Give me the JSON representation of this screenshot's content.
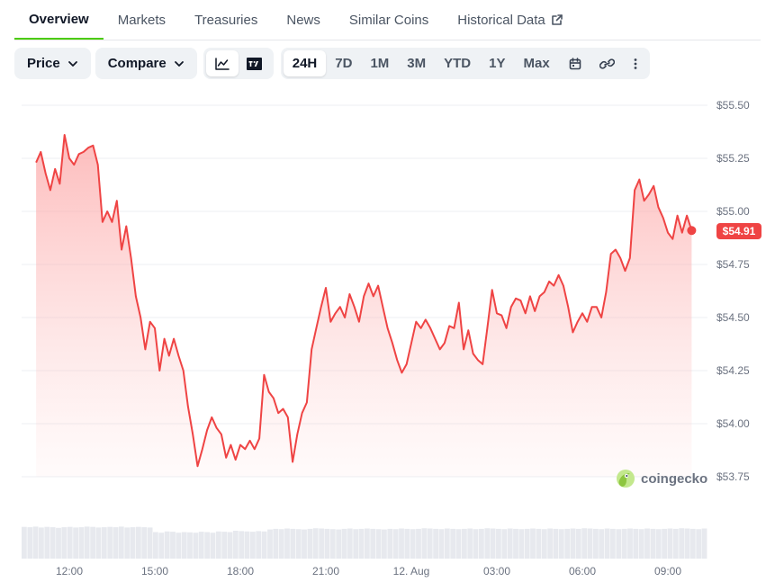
{
  "tabs": [
    {
      "label": "Overview",
      "active": true
    },
    {
      "label": "Markets",
      "active": false
    },
    {
      "label": "Treasuries",
      "active": false
    },
    {
      "label": "News",
      "active": false
    },
    {
      "label": "Similar Coins",
      "active": false
    },
    {
      "label": "Historical Data",
      "active": false,
      "icon": "external-link-icon"
    }
  ],
  "toolbar": {
    "price_label": "Price",
    "compare_label": "Compare",
    "chart_types": [
      {
        "icon": "line-chart-icon",
        "active": true
      },
      {
        "icon": "tradingview-icon",
        "active": false
      }
    ],
    "ranges": [
      {
        "label": "24H",
        "active": true
      },
      {
        "label": "7D",
        "active": false
      },
      {
        "label": "1M",
        "active": false
      },
      {
        "label": "3M",
        "active": false
      },
      {
        "label": "YTD",
        "active": false
      },
      {
        "label": "1Y",
        "active": false
      },
      {
        "label": "Max",
        "active": false
      }
    ],
    "extra_icons": [
      "calendar-icon",
      "link-icon",
      "more-vertical-icon"
    ]
  },
  "watermark": "coingecko",
  "colors": {
    "accent": "#4bcc00",
    "line": "#ef4444",
    "fill": "#fecaca",
    "volume": "#e5e7eb"
  },
  "chart_data": {
    "type": "area",
    "xlabel": "",
    "ylabel": "",
    "x_ticks": [
      "12:00",
      "15:00",
      "18:00",
      "21:00",
      "12. Aug",
      "03:00",
      "06:00",
      "09:00"
    ],
    "y_ticks": [
      "$55.50",
      "$55.25",
      "$55.00",
      "$54.75",
      "$54.50",
      "$54.25",
      "$54.00",
      "$53.75"
    ],
    "ylim": [
      53.75,
      55.5
    ],
    "grid": true,
    "current_price_label": "$54.91",
    "current_price": 54.91,
    "series": [
      {
        "points": [
          [
            "10:50",
            55.23
          ],
          [
            "11:00",
            55.28
          ],
          [
            "11:10",
            55.18
          ],
          [
            "11:20",
            55.1
          ],
          [
            "11:30",
            55.2
          ],
          [
            "11:40",
            55.13
          ],
          [
            "11:50",
            55.36
          ],
          [
            "12:00",
            55.25
          ],
          [
            "12:10",
            55.22
          ],
          [
            "12:20",
            55.27
          ],
          [
            "12:30",
            55.28
          ],
          [
            "12:40",
            55.3
          ],
          [
            "12:50",
            55.31
          ],
          [
            "13:00",
            55.22
          ],
          [
            "13:10",
            54.95
          ],
          [
            "13:20",
            55.0
          ],
          [
            "13:30",
            54.95
          ],
          [
            "13:40",
            55.05
          ],
          [
            "13:50",
            54.82
          ],
          [
            "14:00",
            54.93
          ],
          [
            "14:10",
            54.78
          ],
          [
            "14:20",
            54.6
          ],
          [
            "14:30",
            54.5
          ],
          [
            "14:40",
            54.35
          ],
          [
            "14:50",
            54.48
          ],
          [
            "15:00",
            54.45
          ],
          [
            "15:10",
            54.25
          ],
          [
            "15:20",
            54.4
          ],
          [
            "15:30",
            54.32
          ],
          [
            "15:40",
            54.4
          ],
          [
            "15:50",
            54.32
          ],
          [
            "16:00",
            54.25
          ],
          [
            "16:10",
            54.08
          ],
          [
            "16:20",
            53.95
          ],
          [
            "16:30",
            53.8
          ],
          [
            "16:40",
            53.88
          ],
          [
            "16:50",
            53.97
          ],
          [
            "17:00",
            54.03
          ],
          [
            "17:10",
            53.98
          ],
          [
            "17:20",
            53.95
          ],
          [
            "17:30",
            53.84
          ],
          [
            "17:40",
            53.9
          ],
          [
            "17:50",
            53.83
          ],
          [
            "18:00",
            53.9
          ],
          [
            "18:10",
            53.88
          ],
          [
            "18:20",
            53.92
          ],
          [
            "18:30",
            53.88
          ],
          [
            "18:40",
            53.93
          ],
          [
            "18:50",
            54.23
          ],
          [
            "19:00",
            54.15
          ],
          [
            "19:10",
            54.12
          ],
          [
            "19:20",
            54.05
          ],
          [
            "19:30",
            54.07
          ],
          [
            "19:40",
            54.03
          ],
          [
            "19:50",
            53.82
          ],
          [
            "20:00",
            53.95
          ],
          [
            "20:10",
            54.05
          ],
          [
            "20:20",
            54.1
          ],
          [
            "20:30",
            54.35
          ],
          [
            "20:40",
            54.45
          ],
          [
            "20:50",
            54.55
          ],
          [
            "21:00",
            54.64
          ],
          [
            "21:10",
            54.48
          ],
          [
            "21:20",
            54.52
          ],
          [
            "21:30",
            54.55
          ],
          [
            "21:40",
            54.5
          ],
          [
            "21:50",
            54.61
          ],
          [
            "22:00",
            54.55
          ],
          [
            "22:10",
            54.48
          ],
          [
            "22:20",
            54.6
          ],
          [
            "22:30",
            54.66
          ],
          [
            "22:40",
            54.6
          ],
          [
            "22:50",
            54.65
          ],
          [
            "23:00",
            54.55
          ],
          [
            "23:10",
            54.45
          ],
          [
            "23:20",
            54.38
          ],
          [
            "23:30",
            54.3
          ],
          [
            "23:40",
            54.24
          ],
          [
            "23:50",
            54.28
          ],
          [
            "00:00",
            54.38
          ],
          [
            "00:10",
            54.48
          ],
          [
            "00:20",
            54.45
          ],
          [
            "00:30",
            54.49
          ],
          [
            "00:40",
            54.45
          ],
          [
            "00:50",
            54.4
          ],
          [
            "01:00",
            54.35
          ],
          [
            "01:10",
            54.38
          ],
          [
            "01:20",
            54.46
          ],
          [
            "01:30",
            54.45
          ],
          [
            "01:40",
            54.57
          ],
          [
            "01:50",
            54.35
          ],
          [
            "02:00",
            54.44
          ],
          [
            "02:10",
            54.33
          ],
          [
            "02:20",
            54.3
          ],
          [
            "02:30",
            54.28
          ],
          [
            "02:40",
            54.45
          ],
          [
            "02:50",
            54.63
          ],
          [
            "03:00",
            54.52
          ],
          [
            "03:10",
            54.51
          ],
          [
            "03:20",
            54.45
          ],
          [
            "03:30",
            54.55
          ],
          [
            "03:40",
            54.59
          ],
          [
            "03:50",
            54.58
          ],
          [
            "04:00",
            54.52
          ],
          [
            "04:10",
            54.6
          ],
          [
            "04:20",
            54.53
          ],
          [
            "04:30",
            54.6
          ],
          [
            "04:40",
            54.62
          ],
          [
            "04:50",
            54.67
          ],
          [
            "05:00",
            54.65
          ],
          [
            "05:10",
            54.7
          ],
          [
            "05:20",
            54.65
          ],
          [
            "05:30",
            54.55
          ],
          [
            "05:40",
            54.43
          ],
          [
            "05:50",
            54.48
          ],
          [
            "06:00",
            54.52
          ],
          [
            "06:10",
            54.48
          ],
          [
            "06:20",
            54.55
          ],
          [
            "06:30",
            54.55
          ],
          [
            "06:40",
            54.5
          ],
          [
            "06:50",
            54.62
          ],
          [
            "07:00",
            54.8
          ],
          [
            "07:10",
            54.82
          ],
          [
            "07:20",
            54.78
          ],
          [
            "07:30",
            54.72
          ],
          [
            "07:40",
            54.78
          ],
          [
            "07:50",
            55.1
          ],
          [
            "08:00",
            55.15
          ],
          [
            "08:10",
            55.05
          ],
          [
            "08:20",
            55.08
          ],
          [
            "08:30",
            55.12
          ],
          [
            "08:40",
            55.02
          ],
          [
            "08:50",
            54.97
          ],
          [
            "09:00",
            54.9
          ],
          [
            "09:10",
            54.87
          ],
          [
            "09:20",
            54.98
          ],
          [
            "09:30",
            54.9
          ],
          [
            "09:40",
            54.98
          ],
          [
            "09:50",
            54.91
          ]
        ]
      }
    ],
    "volume": [
      0.98,
      0.97,
      0.99,
      0.96,
      0.98,
      0.97,
      0.95,
      0.97,
      0.98,
      0.96,
      0.97,
      0.99,
      0.98,
      0.96,
      0.97,
      0.98,
      0.97,
      0.99,
      0.96,
      0.97,
      0.98,
      0.97,
      0.96,
      0.82,
      0.8,
      0.84,
      0.83,
      0.8,
      0.82,
      0.81,
      0.8,
      0.83,
      0.82,
      0.8,
      0.84,
      0.83,
      0.82,
      0.86,
      0.85,
      0.84,
      0.83,
      0.85,
      0.84,
      0.9,
      0.92,
      0.91,
      0.93,
      0.92,
      0.91,
      0.9,
      0.92,
      0.94,
      0.93,
      0.92,
      0.91,
      0.9,
      0.92,
      0.93,
      0.91,
      0.92,
      0.93,
      0.92,
      0.91,
      0.9,
      0.92,
      0.91,
      0.93,
      0.92,
      0.91,
      0.92,
      0.94,
      0.93,
      0.92,
      0.91,
      0.93,
      0.92,
      0.91,
      0.92,
      0.93,
      0.91,
      0.92,
      0.94,
      0.93,
      0.92,
      0.91,
      0.93,
      0.92,
      0.91,
      0.92,
      0.93,
      0.92,
      0.91,
      0.93,
      0.92,
      0.91,
      0.92,
      0.93,
      0.92,
      0.94,
      0.93,
      0.92,
      0.91,
      0.93,
      0.92,
      0.91,
      0.92,
      0.93,
      0.92,
      0.91,
      0.93,
      0.92,
      0.91,
      0.92,
      0.93,
      0.92,
      0.94,
      0.93,
      0.92,
      0.91,
      0.93
    ]
  }
}
